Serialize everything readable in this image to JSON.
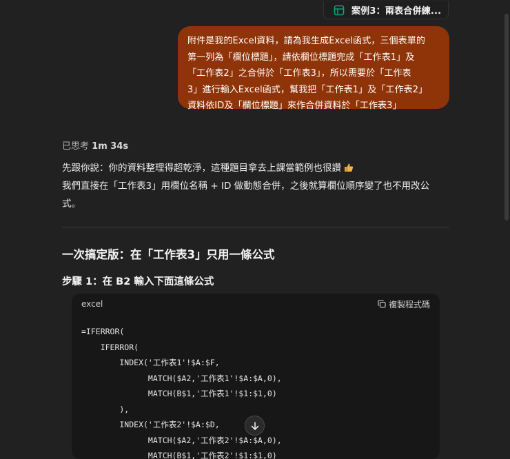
{
  "file_chip": {
    "name": "案例3：兩表合併練..."
  },
  "user_message": {
    "lines": [
      "附件是我的Excel資料，請為我生成Excel函式，三個表單的",
      "第一列為「欄位標題」，請依欄位標題完成「工作表1」及",
      "「工作表2」之合併於「工作表3」，所以需要於「工作表",
      "3」進行輸入Excel函式，幫我把「工作表1」及「工作表2」",
      "資料依ID及「欄位標題」來作合併資料於「工作表3」"
    ]
  },
  "thought": {
    "label": "已思考",
    "duration": "1m 34s"
  },
  "reply": {
    "line1": "先跟你說：你的資料整理得超乾淨，這種題目拿去上課當範例也很讚",
    "line2": "我們直接在「工作表3」用欄位名稱 + ID 做動態合併，之後就算欄位順序變了也不用改公",
    "line3": "式。"
  },
  "heading": "一次搞定版：在「工作表3」只用一條公式",
  "subheading": "步驟 1：在 B2 輸入下面這條公式",
  "code_block": {
    "language": "excel",
    "copy_label": "複製程式碼",
    "lines": [
      "=IFERROR(",
      "    IFERROR(",
      "        INDEX('工作表1'!$A:$F,",
      "              MATCH($A2,'工作表1'!$A:$A,0),",
      "              MATCH(B$1,'工作表1'!$1:$1,0)",
      "        ),",
      "        INDEX('工作表2'!$A:$D,",
      "              MATCH($A2,'工作表2'!$A:$A,0),",
      "              MATCH(B$1,'工作表2'!$1:$1,0)"
    ]
  },
  "colors": {
    "bubble": "#8f3309",
    "background": "#212121",
    "code_bg": "#171717",
    "sheet_icon": "#10a37f"
  },
  "icons": [
    "spreadsheet-icon",
    "thumbs-up-icon",
    "copy-icon",
    "arrow-down-icon"
  ]
}
